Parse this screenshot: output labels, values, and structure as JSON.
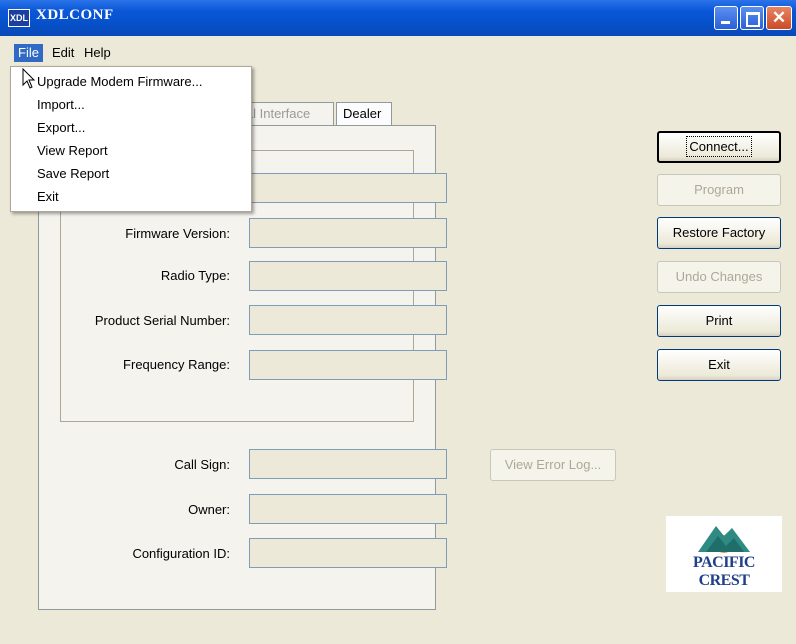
{
  "window": {
    "title": "XDLCONF",
    "icon_text": "XDL"
  },
  "menubar": {
    "file": "File",
    "edit": "Edit",
    "help": "Help"
  },
  "file_menu": {
    "items": [
      "Upgrade Modem Firmware...",
      "Import...",
      "Export...",
      "View Report",
      "Save Report",
      "Exit"
    ]
  },
  "tabs": {
    "serial_interface": "ial Interface",
    "dealer": "Dealer"
  },
  "form": {
    "firmware_version": "Firmware Version:",
    "radio_type": "Radio Type:",
    "product_serial_number": "Product Serial Number:",
    "frequency_range": "Frequency Range:",
    "call_sign": "Call Sign:",
    "owner": "Owner:",
    "configuration_id": "Configuration ID:"
  },
  "buttons": {
    "connect": "Connect...",
    "program": "Program",
    "restore_factory": "Restore Factory",
    "undo_changes": "Undo Changes",
    "print": "Print",
    "exit": "Exit",
    "view_error_log": "View Error Log..."
  },
  "logo": {
    "text": "PACIFIC CREST",
    "colors": {
      "mountain": "#2f8a84",
      "text": "#1e3f8a",
      "sun": "#e8a23a"
    }
  },
  "colors": {
    "titlebar": "#0a57d8",
    "menu_highlight": "#316ac5",
    "background": "#ece9d8"
  }
}
